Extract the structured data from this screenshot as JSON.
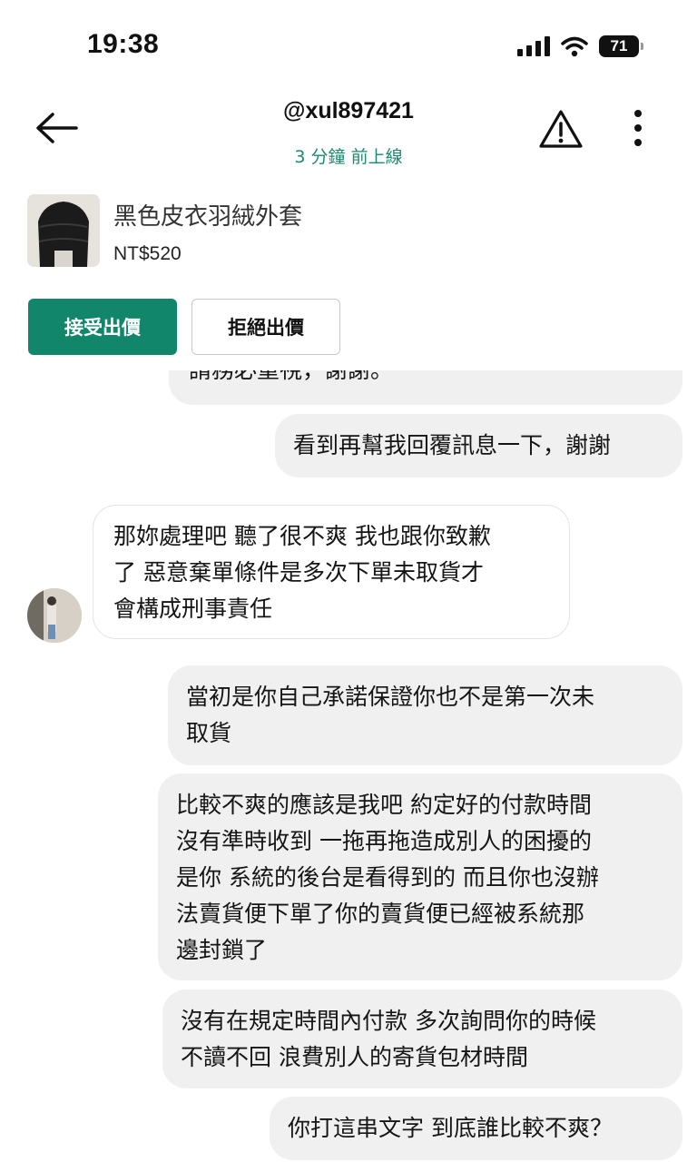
{
  "status_bar": {
    "time": "19:38",
    "battery": "71"
  },
  "header": {
    "username": "@xul897421",
    "last_online": "3 分鐘 前上線"
  },
  "product": {
    "title": "黑色皮衣羽絨外套",
    "price": "NT$520"
  },
  "actions": {
    "accept_label": "接受出價",
    "decline_label": "拒絕出價"
  },
  "messages": [
    {
      "sender": "other",
      "text": "請務必重視，謝謝。"
    },
    {
      "sender": "me",
      "text": "看到再幫我回覆訊息一下，謝謝"
    },
    {
      "sender": "other",
      "text": "那妳處理吧 聽了很不爽 我也跟你致歉\n了 惡意棄單條件是多次下單未取貨才\n會構成刑事責任"
    },
    {
      "sender": "me",
      "text": "當初是你自己承諾保證你也不是第一次未\n取貨"
    },
    {
      "sender": "me",
      "text": "比較不爽的應該是我吧 約定好的付款時間\n沒有準時收到 一拖再拖造成別人的困擾的\n是你 系統的後台是看得到的 而且你也沒辦\n法賣貨便下單了你的賣貨便已經被系統那\n邊封鎖了"
    },
    {
      "sender": "me",
      "text": "沒有在規定時間內付款 多次詢問你的時候\n不讀不回 浪費別人的寄貨包材時間"
    },
    {
      "sender": "me",
      "text": "你打這串文字 到底誰比較不爽？"
    }
  ],
  "colors": {
    "brand_green": "#12866a",
    "online_text": "#1c8a6f",
    "bubble_bg": "#f0f0f0"
  },
  "icons": [
    "signal-icon",
    "wifi-icon",
    "battery-icon",
    "back-arrow-icon",
    "warning-icon",
    "more-vertical-icon"
  ]
}
